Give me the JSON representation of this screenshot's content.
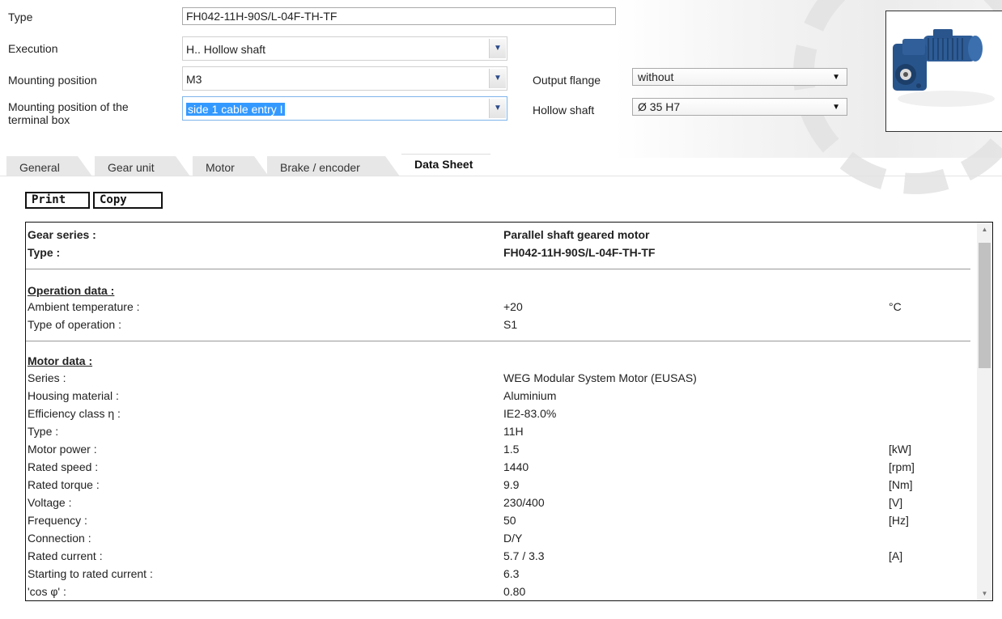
{
  "header": {
    "type_label": "Type",
    "type_value": "FH042-11H-90S/L-04F-TH-TF",
    "execution_label": "Execution",
    "execution_value": "H.. Hollow shaft",
    "mounting_label": "Mounting position",
    "mounting_value": "M3",
    "terminal_label_1": "Mounting position of the",
    "terminal_label_2": "terminal box",
    "terminal_value": "side 1 cable entry I",
    "output_flange_label": "Output flange",
    "output_flange_value": "without",
    "hollow_shaft_label": "Hollow shaft",
    "hollow_shaft_value": "Ø 35 H7"
  },
  "tabs": [
    {
      "label": "General"
    },
    {
      "label": "Gear unit"
    },
    {
      "label": "Motor"
    },
    {
      "label": "Brake / encoder"
    },
    {
      "label": "Data Sheet",
      "active": true
    }
  ],
  "toolbar": {
    "print_label": "Print",
    "copy_label": "Copy"
  },
  "sheet": {
    "gear_series_label": "Gear series :",
    "gear_series_value": "Parallel shaft geared motor",
    "type_label": "Type :",
    "type_value": "FH042-11H-90S/L-04F-TH-TF",
    "operation_title": "Operation data :",
    "operation_rows": [
      {
        "k": "Ambient temperature :",
        "v": "+20",
        "u": "°C"
      },
      {
        "k": "Type of operation :",
        "v": "S1",
        "u": ""
      }
    ],
    "motor_title": "Motor data :",
    "motor_rows": [
      {
        "k": "Series :",
        "v": "WEG Modular System Motor (EUSAS)",
        "u": ""
      },
      {
        "k": "Housing material :",
        "v": "Aluminium",
        "u": ""
      },
      {
        "k": "Efficiency class η :",
        "v": "IE2-83.0%",
        "u": ""
      },
      {
        "k": "Type :",
        "v": "11H",
        "u": ""
      },
      {
        "k": "Motor power :",
        "v": "1.5",
        "u": "[kW]"
      },
      {
        "k": "Rated speed :",
        "v": "1440",
        "u": "[rpm]"
      },
      {
        "k": "Rated torque :",
        "v": "9.9",
        "u": "[Nm]"
      },
      {
        "k": "Voltage :",
        "v": "230/400",
        "u": "[V]"
      },
      {
        "k": "Frequency :",
        "v": "50",
        "u": "[Hz]"
      },
      {
        "k": "Connection :",
        "v": "D/Y",
        "u": ""
      },
      {
        "k": "Rated current :",
        "v": "5.7 / 3.3",
        "u": "[A]"
      },
      {
        "k": "Starting to rated current :",
        "v": "6.3",
        "u": ""
      },
      {
        "k": "'cos φ' :",
        "v": "0.80",
        "u": ""
      }
    ]
  }
}
